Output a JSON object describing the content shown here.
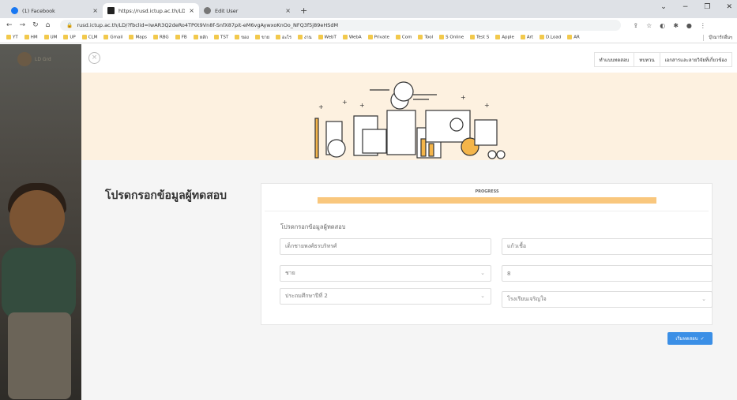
{
  "browser": {
    "tabs": [
      {
        "title": "(1) Facebook",
        "favicon_color": "#1877f2"
      },
      {
        "title": "https://rusd.ictup.ac.th/LD/?fbcl",
        "favicon_color": "#222222"
      },
      {
        "title": "Edit User",
        "favicon_color": "#777777"
      }
    ],
    "tab_close": "×",
    "new_tab": "+",
    "url": "rusd.ictup.ac.th/LD/?fbclid=IwAR3Q2deRo4TP0t9Vn8f-SnfX87pit-eM6vgAywxoKnOo_NFQ3f5j89eHSdM",
    "bookmarks": [
      "YT",
      "HM",
      "UM",
      "UP",
      "CLM",
      "Gmail",
      "Maps",
      "RBG",
      "FB",
      "หลัก",
      "TST",
      "ของ",
      "ขาย",
      "อะไร",
      "งาน",
      "WebT",
      "WebA",
      "Private",
      "Com",
      "Tool",
      "S Online",
      "Test S",
      "Apple",
      "Art",
      "D.Load",
      "AR"
    ],
    "other_bookmarks": "บุ๊กมาร์กอื่นๆ"
  },
  "sidebar": {
    "logo_text": "LD Grd"
  },
  "nav": {
    "close": "×",
    "items": [
      "ทำแบบทดสอบ",
      "ทบทวน",
      "เอกสารและลายวิจัยที่เกี่ยวข้อง"
    ]
  },
  "main": {
    "title": "โปรดกรอกข้อมูลผู้ทดสอบ",
    "progress_label": "PROGRESS",
    "progress_value": 1.0,
    "section_title": "โปรดกรอกข้อมูลผู้ทดสอบ",
    "fields": {
      "name": "เด็กชายพงศ์ธรบริทรศ์",
      "nickname": "แก้วเชื้อ",
      "gender": "ชาย",
      "age": "8",
      "grade": "ประถมศึกษาปีที่ 2",
      "school": "โรงเรียนเจริญใจ"
    },
    "start_button": "เริ่มทดสอบ"
  },
  "colors": {
    "accent": "#3b8fe6",
    "progress": "#f9c77d",
    "banner": "#fdf1e0"
  }
}
